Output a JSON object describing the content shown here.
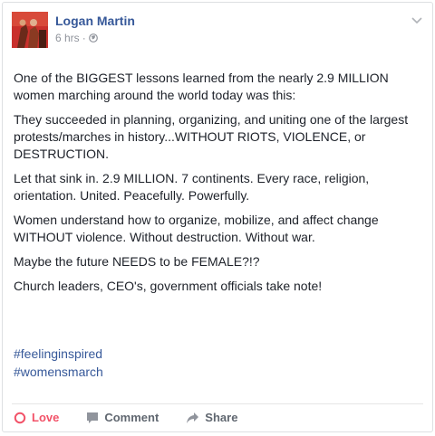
{
  "post": {
    "author": "Logan Martin",
    "time": "6 hrs",
    "separator": "·",
    "paragraphs": [
      "One of the BIGGEST lessons learned from the nearly 2.9 MILLION women marching around the world today was this:",
      "They succeeded in planning, organizing, and uniting one of the largest protests/marches in history...WITHOUT RIOTS, VIOLENCE, or DESTRUCTION.",
      "Let that sink in. 2.9 MILLION. 7 continents. Every race, religion, orientation. United. Peacefully. Powerfully.",
      "Women understand how to organize, mobilize, and affect change WITHOUT violence. Without destruction. Without war.",
      "Maybe the future NEEDS to be FEMALE?!?",
      "Church leaders, CEO's, government officials take note!"
    ],
    "hashtags": [
      "#feelinginspired",
      "#womensmarch"
    ]
  },
  "actions": {
    "love": "Love",
    "comment": "Comment",
    "share": "Share"
  },
  "icons": {
    "globe": "globe-icon",
    "chevron": "chevron-down-icon",
    "love": "heart-icon",
    "comment": "comment-icon",
    "share": "share-arrow-icon"
  },
  "colors": {
    "name_link": "#365899",
    "love": "#f25268",
    "muted": "#90949c",
    "avatar_bg": "#c9302c"
  }
}
